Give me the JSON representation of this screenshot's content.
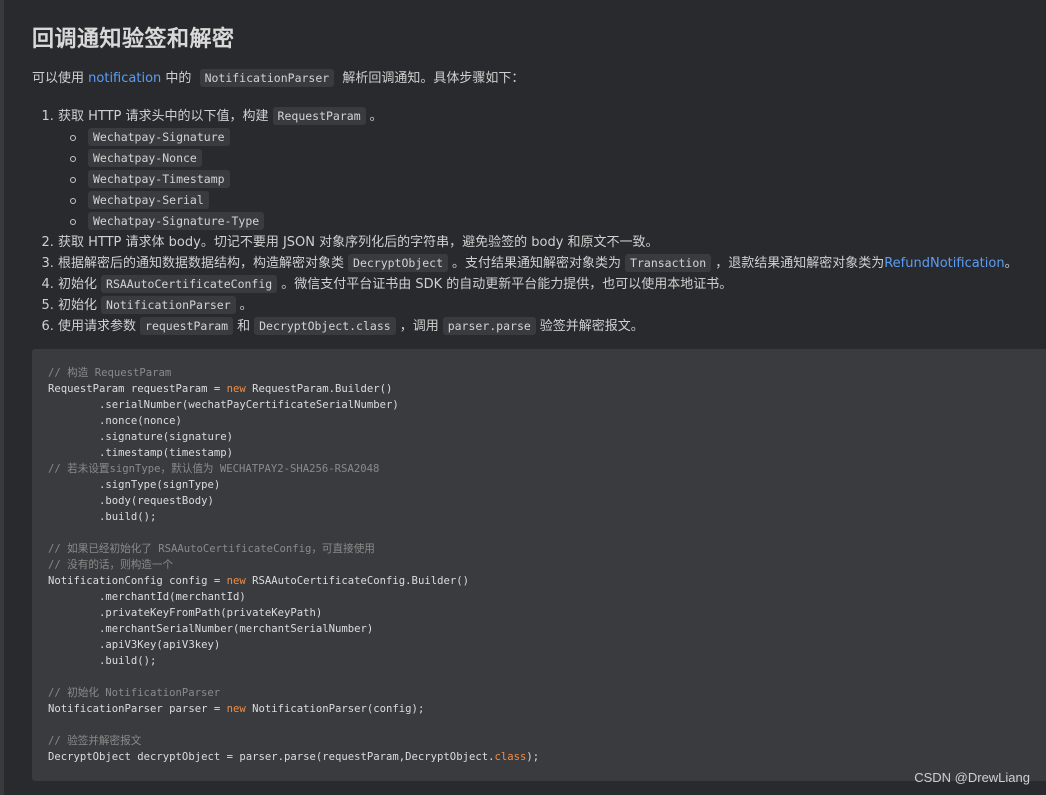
{
  "title": "回调通知验签和解密",
  "intro": {
    "prefix": "可以使用",
    "link": "notification",
    "middle": "中的",
    "code": "NotificationParser",
    "suffix": "解析回调通知。具体步骤如下："
  },
  "steps": [
    {
      "text_a": "获取 HTTP 请求头中的以下值，构建",
      "code_a": "RequestParam",
      "text_b": "。"
    },
    {
      "text_a": "获取 HTTP 请求体 body。切记不要用 JSON 对象序列化后的字符串，避免验签的 body 和原文不一致。"
    },
    {
      "text_a": "根据解密后的通知数据数据结构，构造解密对象类",
      "code_a": "DecryptObject",
      "text_b": "。支付结果通知解密对象类为",
      "code_b": "Transaction",
      "text_c": "，退款结果通知解密对象类为",
      "link": "RefundNotification",
      "text_d": "。"
    },
    {
      "text_a": "初始化",
      "code_a": "RSAAutoCertificateConfig",
      "text_b": "。微信支付平台证书由 SDK 的自动更新平台能力提供，也可以使用本地证书。"
    },
    {
      "text_a": "初始化",
      "code_a": "NotificationParser",
      "text_b": "。"
    },
    {
      "text_a": "使用请求参数",
      "code_a": "requestParam",
      "text_b": "和",
      "code_b": "DecryptObject.class",
      "text_c": "，调用",
      "code_c": "parser.parse",
      "text_d": "验签并解密报文。"
    }
  ],
  "headers": [
    "Wechatpay-Signature",
    "Wechatpay-Nonce",
    "Wechatpay-Timestamp",
    "Wechatpay-Serial",
    "Wechatpay-Signature-Type"
  ],
  "code": {
    "l1": "// 构造 RequestParam",
    "l2a": "RequestParam requestParam = ",
    "l2k": "new",
    "l2b": " RequestParam.Builder()",
    "l3": "        .serialNumber(wechatPayCertificateSerialNumber)",
    "l4": "        .nonce(nonce)",
    "l5": "        .signature(signature)",
    "l6": "        .timestamp(timestamp)",
    "l7": "// 若未设置signType，默认值为 WECHATPAY2-SHA256-RSA2048",
    "l8": "        .signType(signType)",
    "l9": "        .body(requestBody)",
    "l10": "        .build();",
    "l12": "// 如果已经初始化了 RSAAutoCertificateConfig，可直接使用",
    "l13": "// 没有的话，则构造一个",
    "l14a": "NotificationConfig config = ",
    "l14k": "new",
    "l14b": " RSAAutoCertificateConfig.Builder()",
    "l15": "        .merchantId(merchantId)",
    "l16": "        .privateKeyFromPath(privateKeyPath)",
    "l17": "        .merchantSerialNumber(merchantSerialNumber)",
    "l18": "        .apiV3Key(apiV3key)",
    "l19": "        .build();",
    "l21": "// 初始化 NotificationParser",
    "l22a": "NotificationParser parser = ",
    "l22k": "new",
    "l22b": " NotificationParser(config);",
    "l24": "// 验签并解密报文",
    "l25a": "DecryptObject decryptObject = parser.parse(requestParam,DecryptObject.",
    "l25k": "class",
    "l25b": ");"
  },
  "watermark": "CSDN @DrewLiang",
  "colors": {
    "background": "#292a2d",
    "code_background": "#3a3b3e",
    "link": "#5b9cf5",
    "keyword": "#f08d49",
    "comment": "#8a8a8a"
  }
}
